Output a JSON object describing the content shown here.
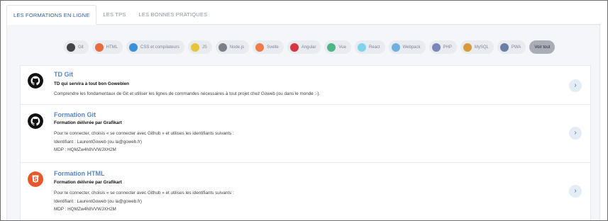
{
  "tabs": [
    {
      "label": "LES FORMATIONS EN LIGNE",
      "active": true
    },
    {
      "label": "LES TPS",
      "active": false
    },
    {
      "label": "LES BONNES PRATIQUES",
      "active": false
    }
  ],
  "filters": [
    {
      "label": "Git",
      "icon": "git-icon",
      "color": "#444444"
    },
    {
      "label": "HTML",
      "icon": "html-icon",
      "color": "#e86a3f"
    },
    {
      "label": "CSS et compilateurs",
      "icon": "css-icon",
      "color": "#3b8fd6"
    },
    {
      "label": "JS",
      "icon": "js-icon",
      "color": "#e8c43a"
    },
    {
      "label": "Node.js",
      "icon": "nodejs-icon",
      "color": "#7a7f88"
    },
    {
      "label": "Svelte",
      "icon": "svelte-icon",
      "color": "#f07a4a"
    },
    {
      "label": "Angular",
      "icon": "angular-icon",
      "color": "#d8363f"
    },
    {
      "label": "Vue",
      "icon": "vue-icon",
      "color": "#4eb585"
    },
    {
      "label": "React",
      "icon": "react-icon",
      "color": "#7fd3ec"
    },
    {
      "label": "Webpack",
      "icon": "webpack-icon",
      "color": "#6fb0e0"
    },
    {
      "label": "PHP",
      "icon": "php-icon",
      "color": "#7a86b8"
    },
    {
      "label": "MySQL",
      "icon": "mysql-icon",
      "color": "#d99a3e"
    },
    {
      "label": "PWA",
      "icon": "pwa-icon",
      "color": "#6a7fa6"
    },
    {
      "label": "Voir tout",
      "icon": "",
      "color": "#a9aeb6",
      "active": true
    }
  ],
  "courses": [
    {
      "logo": "github-icon",
      "title": "TD Git",
      "subtitle": "TD qui servira à tout bon Gowebien",
      "lines": [
        "Comprendre les fondamentaux de Git et utiliser les lignes de commandes nécessaires à tout projet chez Goweb (ou dans le monde :-)."
      ]
    },
    {
      "logo": "github-icon",
      "title": "Formation Git",
      "subtitle": "Formation délivrée par Grafikart",
      "lines": [
        "Pour te connecter, choisis « se connecter avec Github » et utilises les identifiants suivants :",
        "Identifiant : LaurentGoweb (ou la@goweb.fr)",
        "MDP : HQMZw4h8VVWJXH2M"
      ]
    },
    {
      "logo": "html5-icon",
      "title": "Formation HTML",
      "subtitle": "Formation délivrée par Grafikart",
      "lines": [
        "Pour te connecter, choisis « se connecter avec Github » et utilises les identifiants suivants :",
        "Identifiant : LaurentGoweb (ou la@goweb.fr)",
        "MDP : HQMZw4h8VVWJXH2M"
      ]
    }
  ],
  "go_glyph": "›"
}
